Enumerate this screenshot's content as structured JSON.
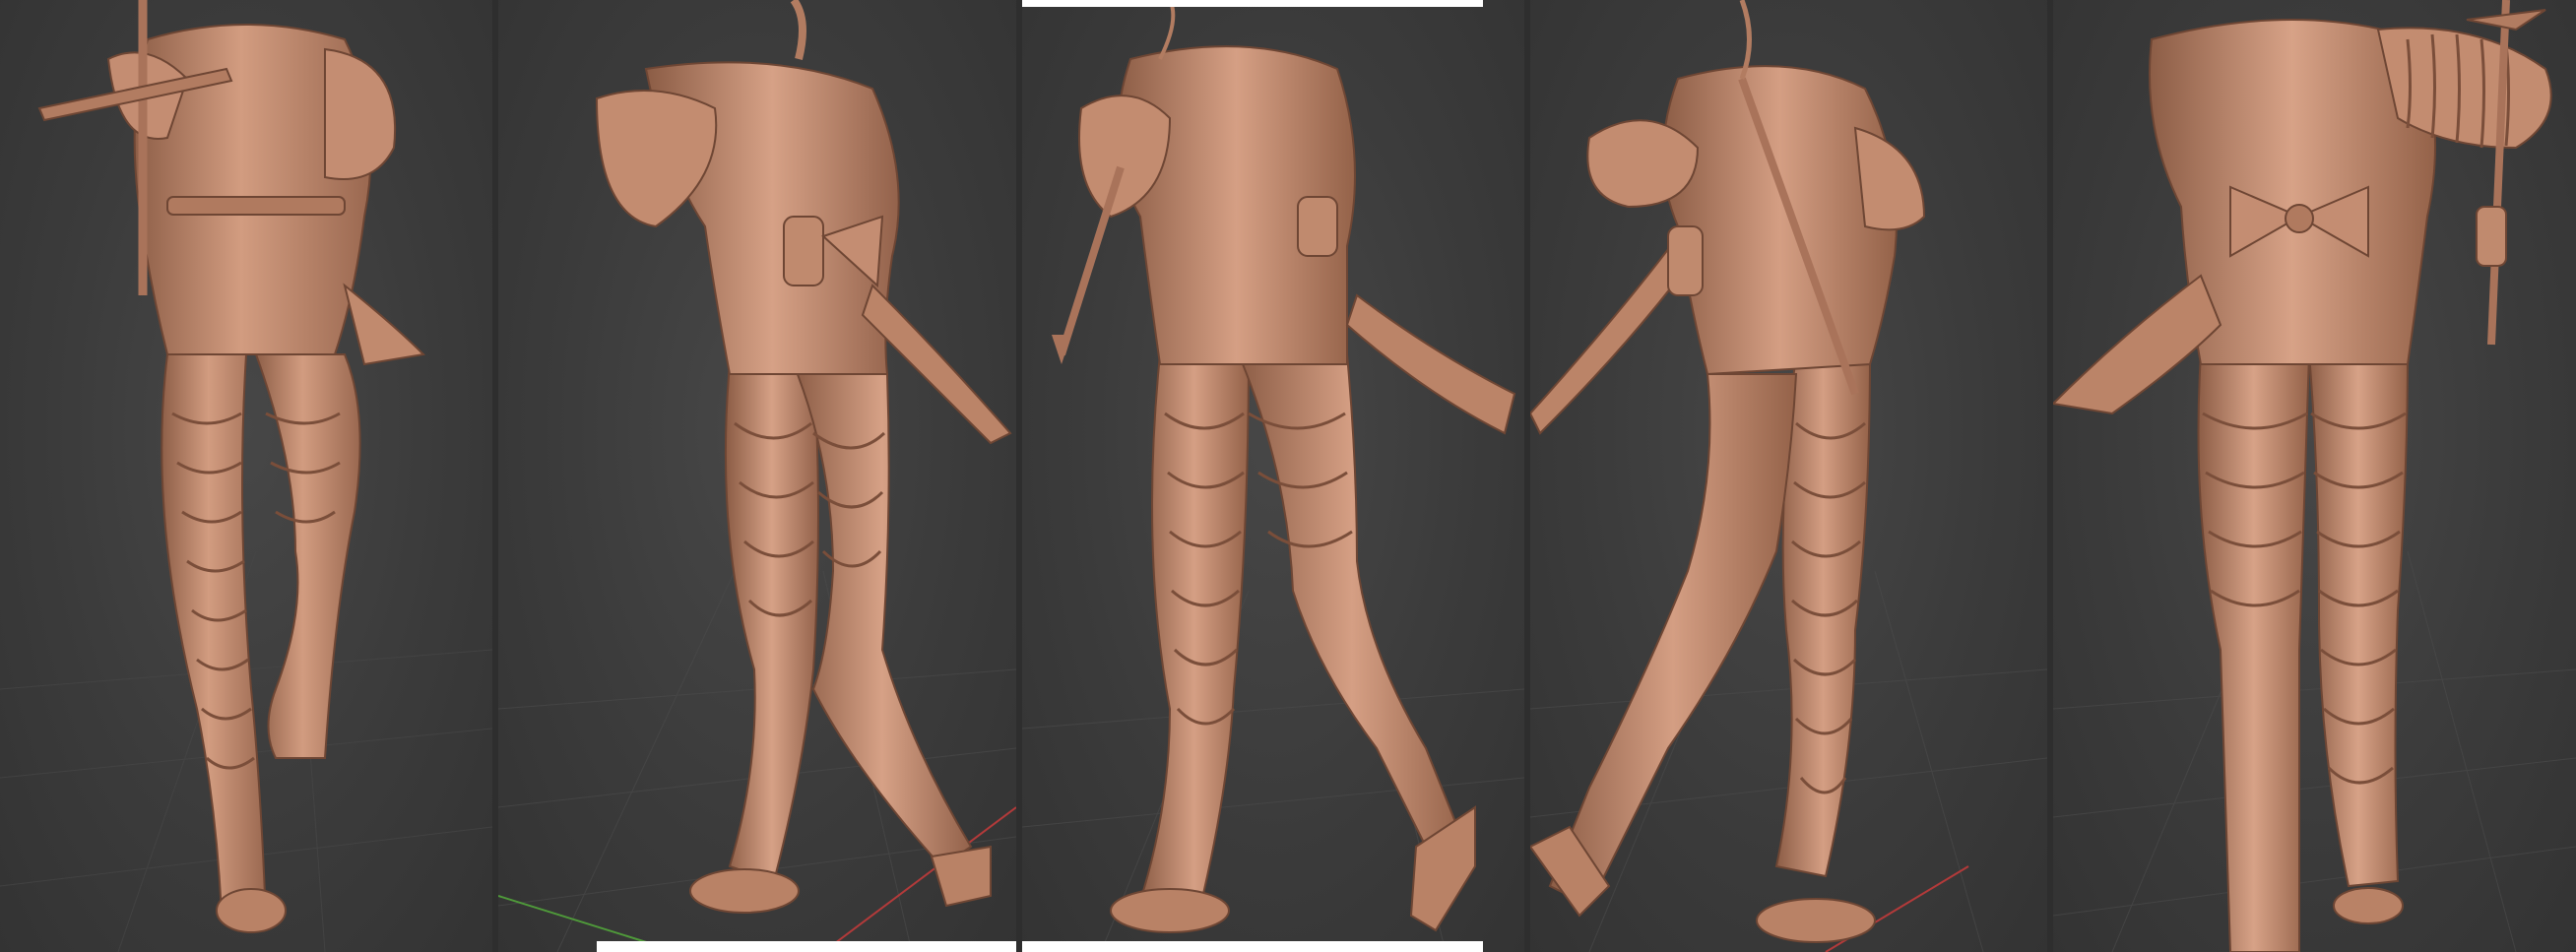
{
  "scene": {
    "description_free": true,
    "background_color": "#3a3a3a",
    "grid_color": "#4a4a4a",
    "model_color": "#c48d72",
    "model_shadow": "#8e5f48",
    "model_highlight": "#e2b39b",
    "axis_x_color": "#b33a3a",
    "axis_y_color": "#4f9a3a"
  },
  "views": [
    {
      "id": "front"
    },
    {
      "id": "back-left"
    },
    {
      "id": "left"
    },
    {
      "id": "right"
    },
    {
      "id": "back"
    }
  ]
}
